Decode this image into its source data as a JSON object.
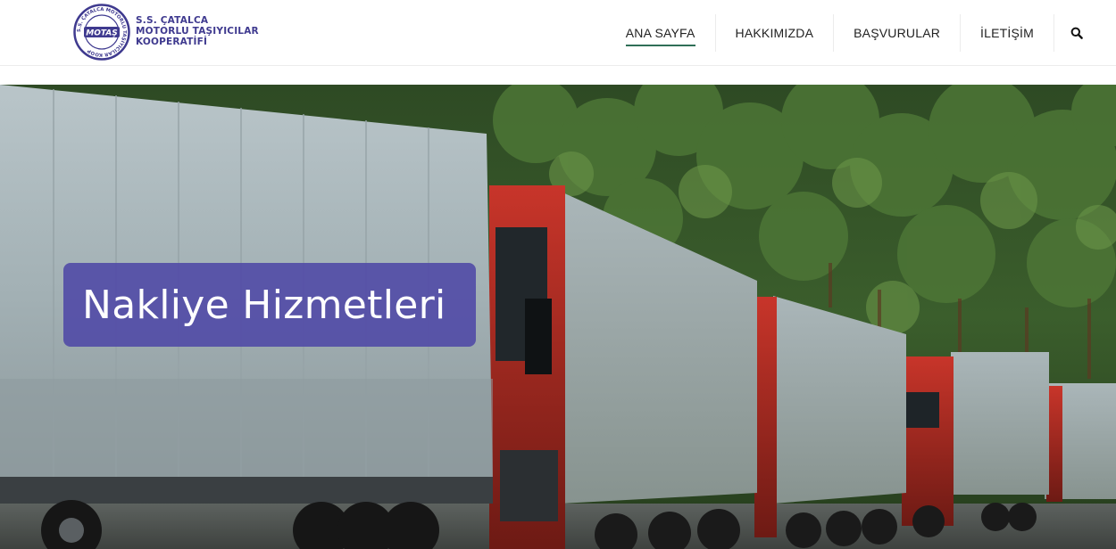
{
  "logo": {
    "seal_text_outer": "S.S. ÇATALCA MOTORLU TAŞIYICILAR KOOP",
    "seal_text_center": "MOTAŞ",
    "name_lines": [
      "S.S. ÇATALCA",
      "MOTORLU TAŞIYICILAR",
      "KOOPERATİFİ"
    ]
  },
  "nav": {
    "items": [
      {
        "label": "ANA SAYFA",
        "active": true
      },
      {
        "label": "HAKKIMIZDA",
        "active": false
      },
      {
        "label": "BAŞVURULAR",
        "active": false
      },
      {
        "label": "İLETİŞİM",
        "active": false
      }
    ],
    "search_icon": "search-icon"
  },
  "hero": {
    "caption": "Nakliye Hizmetleri"
  },
  "colors": {
    "brand": "#3f3a8f",
    "caption_bg": "#4e48a6",
    "nav_active_underline": "#2f6f57"
  }
}
